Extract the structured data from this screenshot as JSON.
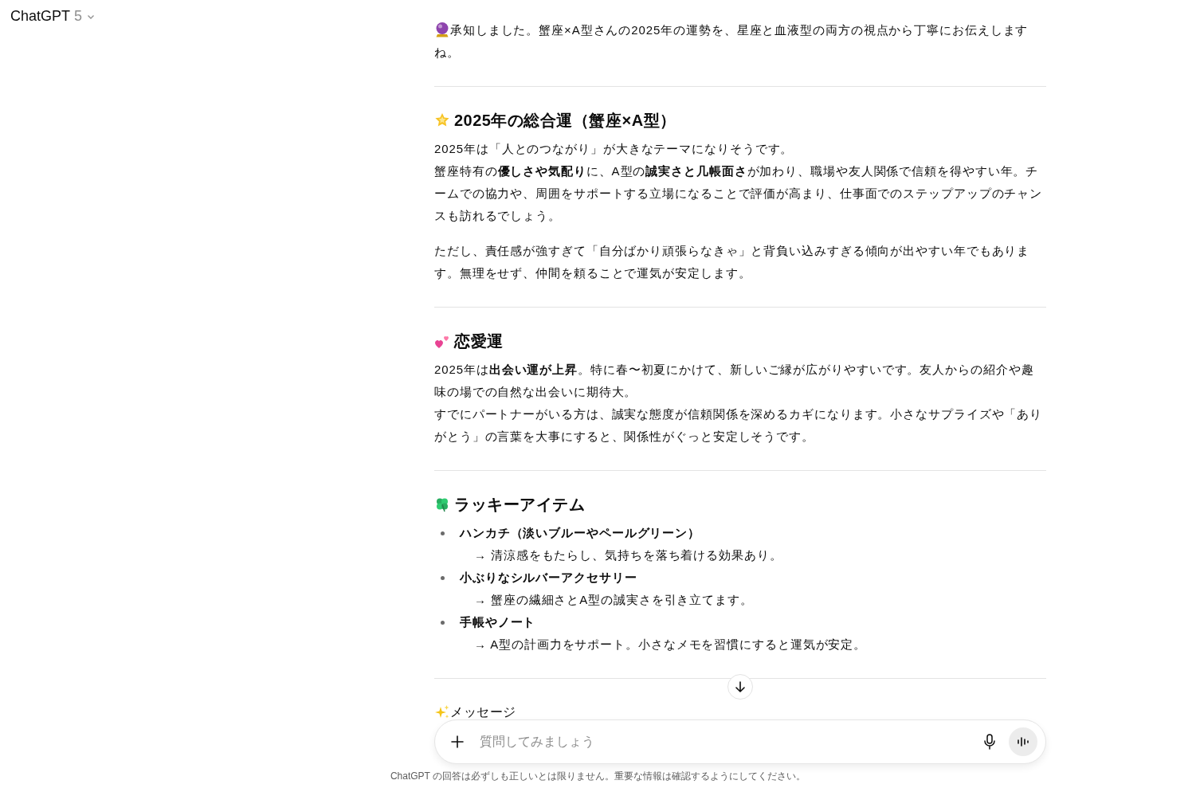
{
  "header": {
    "model": "ChatGPT",
    "version": "5"
  },
  "intro": "承知しました。蟹座×A型さんの2025年の運勢を、星座と血液型の両方の視点から丁寧にお伝えしますね。",
  "sections": [
    {
      "kind": "text",
      "heading": "2025年の総合運（蟹座×A型）",
      "paragraphs": [
        [
          "2025年は「人とのつながり」が大きなテーマになりそうです。",
          "蟹座特有の**優しさや気配り**に、A型の**誠実さと几帳面さ**が加わり、職場や友人関係で信頼を得やすい年。チームでの協力や、周囲をサポートする立場になることで評価が高まり、仕事面でのステップアップのチャンスも訪れるでしょう。"
        ],
        [
          "ただし、責任感が強すぎて「自分ばかり頑張らなきゃ」と背負い込みすぎる傾向が出やすい年でもあります。無理をせず、仲間を頼ることで運気が安定します。"
        ]
      ]
    },
    {
      "kind": "text",
      "heading": "恋愛運",
      "paragraphs": [
        [
          "2025年は**出会い運が上昇**。特に春〜初夏にかけて、新しいご縁が広がりやすいです。友人からの紹介や趣味の場での自然な出会いに期待大。",
          "すでにパートナーがいる方は、誠実な態度が信頼関係を深めるカギになります。小さなサプライズや「ありがとう」の言葉を大事にすると、関係性がぐっと安定しそうです。"
        ]
      ]
    },
    {
      "kind": "list",
      "heading": "ラッキーアイテム",
      "items": [
        {
          "title": "ハンカチ（淡いブルーやペールグリーン）",
          "note": "→ 清涼感をもたらし、気持ちを落ち着ける効果あり。"
        },
        {
          "title": "小ぶりなシルバーアクセサリー",
          "note": "→ 蟹座の繊細さとA型の誠実さを引き立てます。"
        },
        {
          "title": "手帳やノート",
          "note": "→ A型の計画力をサポート。小さなメモを習慣にすると運気が安定。"
        }
      ]
    },
    {
      "kind": "tail",
      "heading": "メッセージ"
    }
  ],
  "composer": {
    "placeholder": "質問してみましょう"
  },
  "disclaimer": "ChatGPT の回答は必ずしも正しいとは限りません。重要な情報は確認するようにしてください。"
}
